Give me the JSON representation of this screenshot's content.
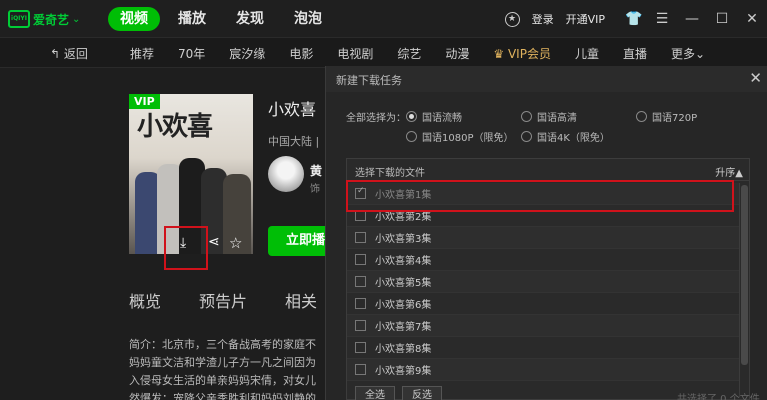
{
  "app": {
    "logo_mark": "iQIYI",
    "logo_text": "爱奇艺",
    "top_nav": [
      {
        "label": "视频",
        "active": true
      },
      {
        "label": "播放",
        "active": false
      },
      {
        "label": "发现",
        "active": false
      },
      {
        "label": "泡泡",
        "active": false
      }
    ],
    "login": "登录",
    "open_vip": "开通VIP"
  },
  "subnav": {
    "back": "返回",
    "items": [
      "推荐",
      "70年",
      "宸汐缘",
      "电影",
      "电视剧",
      "综艺",
      "动漫",
      "VIP会员",
      "儿童",
      "直播",
      "更多"
    ]
  },
  "show": {
    "vip_tag": "VIP",
    "poster_title": "小欢喜",
    "title": "小欢喜",
    "region": "中国大陆",
    "region_sep": "|",
    "actor_name": "黄",
    "actor_role": "饰",
    "play_button": "立即播",
    "tabs": [
      "概览",
      "预告片",
      "相关"
    ],
    "synopsis": [
      "简介：北京市，三个备战高考的家庭不",
      "妈妈童文洁和学渣儿子方一凡之间因为",
      "入侵母女生活的单亲妈妈宋倩，对女儿",
      "然爆发；宠降父亲季胜利和妈妈刘静的"
    ]
  },
  "dialog": {
    "title": "新建下载任务",
    "quality_label": "全部选择为：",
    "qualities": [
      {
        "label": "国语流畅",
        "checked": true
      },
      {
        "label": "国语高清",
        "checked": false
      },
      {
        "label": "国语720P",
        "checked": false
      },
      {
        "label": "国语1080P（限免）",
        "checked": false
      },
      {
        "label": "国语4K（限免）",
        "checked": false
      }
    ],
    "file_header": "选择下载的文件",
    "sort": "升序▲",
    "episodes": [
      {
        "label": "小欢喜第1集",
        "checked": true,
        "disabled": true
      },
      {
        "label": "小欢喜第2集",
        "checked": false
      },
      {
        "label": "小欢喜第3集",
        "checked": false
      },
      {
        "label": "小欢喜第4集",
        "checked": false
      },
      {
        "label": "小欢喜第5集",
        "checked": false
      },
      {
        "label": "小欢喜第6集",
        "checked": false
      },
      {
        "label": "小欢喜第7集",
        "checked": false
      },
      {
        "label": "小欢喜第8集",
        "checked": false
      },
      {
        "label": "小欢喜第9集",
        "checked": false
      }
    ],
    "select_all": "全选",
    "invert": "反选",
    "footer": "共选择了 0 个文件"
  },
  "colors": {
    "accent_green": "#00be06",
    "highlight_red": "#d0121b",
    "vip_gold": "#e0b35e"
  }
}
